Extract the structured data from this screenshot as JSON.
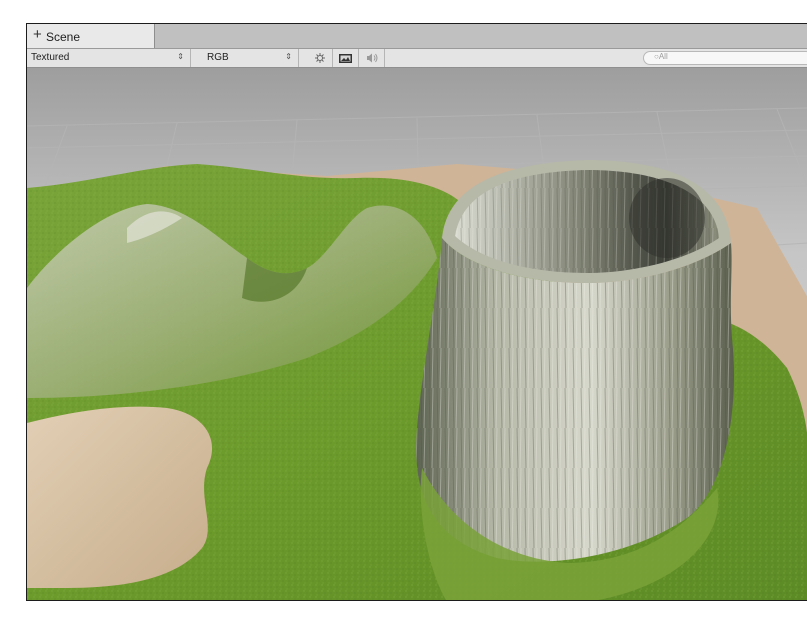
{
  "window": {
    "tab_label": "Scene",
    "tab_icon": "plus-icon"
  },
  "toolbar": {
    "draw_mode": "Textured",
    "render_mode": "RGB",
    "icons": [
      "lighting-icon",
      "image-icon",
      "audio-icon"
    ]
  },
  "search": {
    "placeholder": "All"
  },
  "viewport": {
    "content": "terrain-with-volcano",
    "colors": {
      "grass": "#6f9a2f",
      "sand": "#d8c0a0",
      "rock": "#a9a99a",
      "grid_background": "#c9c9c9"
    }
  }
}
